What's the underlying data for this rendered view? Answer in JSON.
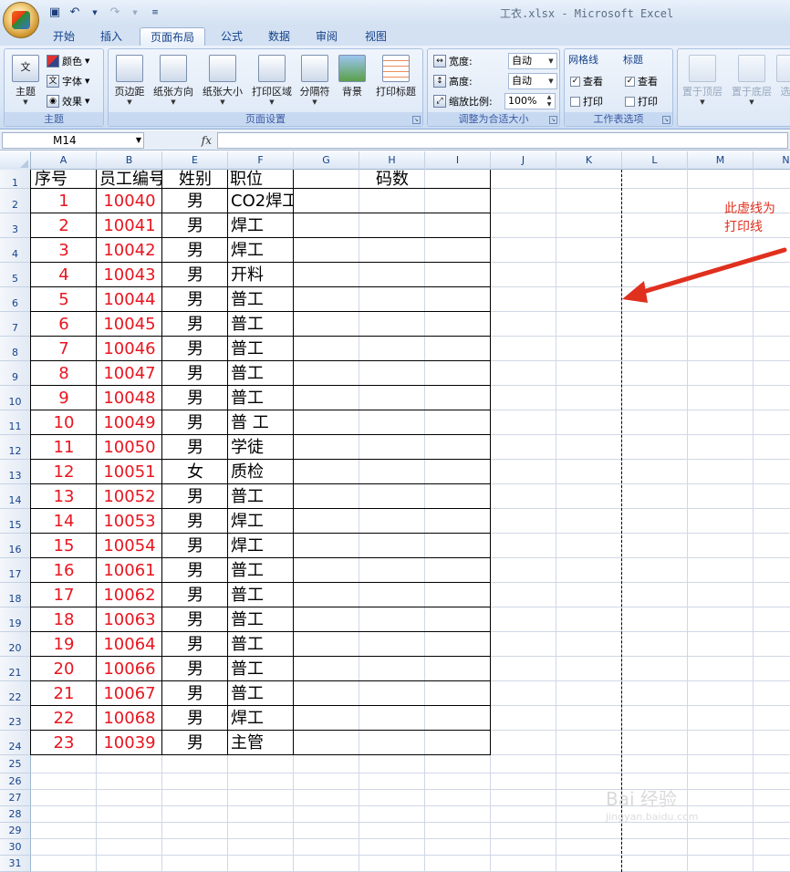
{
  "window": {
    "title": "工衣.xlsx - Microsoft Excel"
  },
  "tabs": [
    {
      "label": "开始"
    },
    {
      "label": "插入"
    },
    {
      "label": "页面布局"
    },
    {
      "label": "公式"
    },
    {
      "label": "数据"
    },
    {
      "label": "审阅"
    },
    {
      "label": "视图"
    }
  ],
  "active_tab": "页面布局",
  "ribbon": {
    "themes": {
      "theme": "主题",
      "colors": "颜色",
      "fonts": "字体",
      "effects": "效果",
      "group": "主题"
    },
    "page_setup": {
      "margins": "页边距",
      "orientation": "纸张方向",
      "size": "纸张大小",
      "print_area": "打印区域",
      "breaks": "分隔符",
      "background": "背景",
      "print_titles": "打印标题",
      "group": "页面设置"
    },
    "scale": {
      "width_label": "宽度:",
      "width_value": "自动",
      "height_label": "高度:",
      "height_value": "自动",
      "scale_label": "缩放比例:",
      "scale_value": "100%",
      "group": "调整为合适大小"
    },
    "sheet_options": {
      "gridlines": "网格线",
      "headings": "标题",
      "view": "查看",
      "print": "打印",
      "group": "工作表选项"
    },
    "arrange": {
      "bring_front": "置于顶层",
      "send_back": "置于底层",
      "selection": "选"
    }
  },
  "formula_bar": {
    "name_box": "M14",
    "fx": "fx",
    "formula": ""
  },
  "columns": [
    "A",
    "B",
    "E",
    "F",
    "G",
    "H",
    "I",
    "J",
    "K",
    "L",
    "M",
    "N"
  ],
  "headers": {
    "a": "序号",
    "b": "员工编号",
    "e": "姓别",
    "f": "职位",
    "gh": "码数"
  },
  "rows": [
    {
      "a": "1",
      "b": "10040",
      "e": "男",
      "f": "CO2焊工"
    },
    {
      "a": "2",
      "b": "10041",
      "e": "男",
      "f": "焊工"
    },
    {
      "a": "3",
      "b": "10042",
      "e": "男",
      "f": "焊工"
    },
    {
      "a": "4",
      "b": "10043",
      "e": "男",
      "f": "开料"
    },
    {
      "a": "5",
      "b": "10044",
      "e": "男",
      "f": "普工"
    },
    {
      "a": "6",
      "b": "10045",
      "e": "男",
      "f": "普工"
    },
    {
      "a": "7",
      "b": "10046",
      "e": "男",
      "f": "普工"
    },
    {
      "a": "8",
      "b": "10047",
      "e": "男",
      "f": "普工"
    },
    {
      "a": "9",
      "b": "10048",
      "e": "男",
      "f": "普工"
    },
    {
      "a": "10",
      "b": "10049",
      "e": "男",
      "f": "普 工"
    },
    {
      "a": "11",
      "b": "10050",
      "e": "男",
      "f": "学徒"
    },
    {
      "a": "12",
      "b": "10051",
      "e": "女",
      "f": "质检"
    },
    {
      "a": "13",
      "b": "10052",
      "e": "男",
      "f": "普工"
    },
    {
      "a": "14",
      "b": "10053",
      "e": "男",
      "f": "焊工"
    },
    {
      "a": "15",
      "b": "10054",
      "e": "男",
      "f": "焊工"
    },
    {
      "a": "16",
      "b": "10061",
      "e": "男",
      "f": "普工"
    },
    {
      "a": "17",
      "b": "10062",
      "e": "男",
      "f": "普工"
    },
    {
      "a": "18",
      "b": "10063",
      "e": "男",
      "f": "普工"
    },
    {
      "a": "19",
      "b": "10064",
      "e": "男",
      "f": "普工"
    },
    {
      "a": "20",
      "b": "10066",
      "e": "男",
      "f": "普工"
    },
    {
      "a": "21",
      "b": "10067",
      "e": "男",
      "f": "普工"
    },
    {
      "a": "22",
      "b": "10068",
      "e": "男",
      "f": "焊工"
    },
    {
      "a": "23",
      "b": "10039",
      "e": "男",
      "f": "主管"
    }
  ],
  "row_numbers": [
    "1",
    "2",
    "3",
    "4",
    "5",
    "6",
    "7",
    "8",
    "9",
    "10",
    "11",
    "12",
    "13",
    "14",
    "15",
    "16",
    "17",
    "18",
    "19",
    "20",
    "21",
    "22",
    "23",
    "24",
    "25",
    "26",
    "27",
    "28",
    "29",
    "30",
    "31"
  ],
  "annotation": {
    "line1": "此虚线为",
    "line2": "打印线"
  },
  "watermark": {
    "text": "Bai 经验",
    "sub": "jingyan.baidu.com"
  },
  "colors": {
    "red": "#e8151f",
    "annotation": "#e0301e"
  }
}
